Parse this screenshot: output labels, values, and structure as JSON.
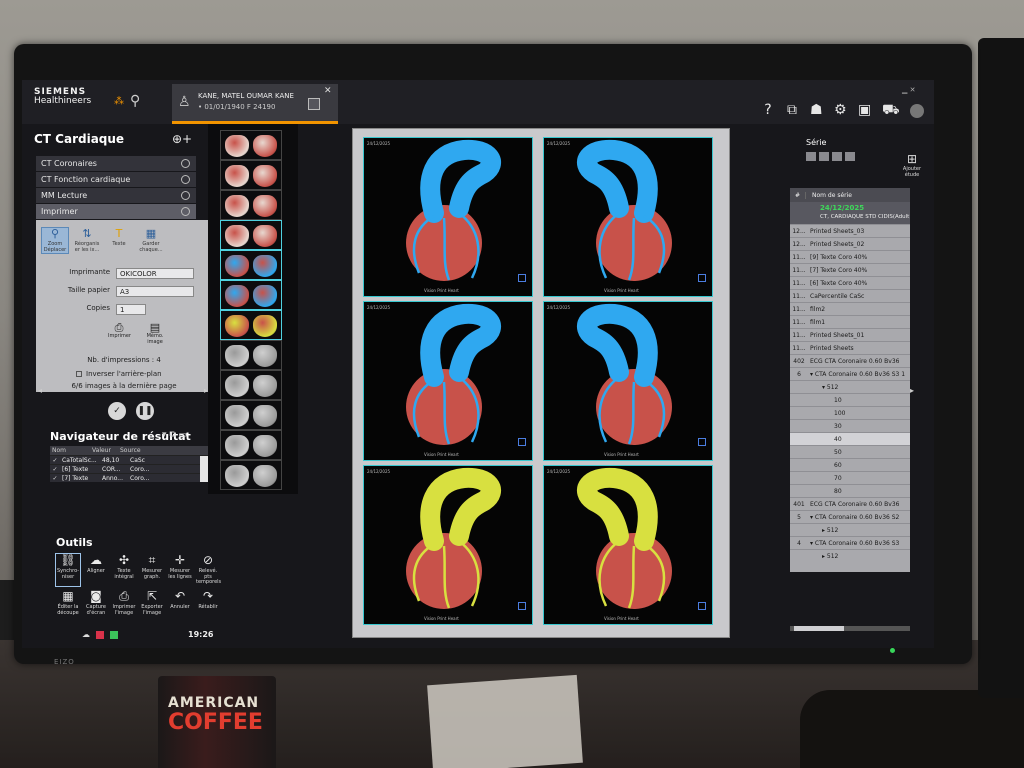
{
  "header": {
    "brand_line1": "SIEMENS",
    "brand_line2": "Healthineers",
    "patient_name": "KANE, MATEL OUMAR KANE",
    "patient_dob": "• 01/01/1940 F 24190",
    "icons": [
      "help-icon",
      "layout-icon",
      "users-icon",
      "gear-icon",
      "toolbox-icon",
      "cart-icon"
    ]
  },
  "left_panel": {
    "title": "CT Cardiaque",
    "protocols": [
      {
        "label": "CT Coronaires"
      },
      {
        "label": "CT Fonction cardiaque"
      },
      {
        "label": "MM Lecture"
      },
      {
        "label": "Imprimer"
      }
    ],
    "print_tools": [
      {
        "label": "Zoom Déplacer",
        "icon": "magnifier-icon"
      },
      {
        "label": "Réorganis er les ix...",
        "icon": "reorder-icon"
      },
      {
        "label": "Texte",
        "icon": "text-icon"
      },
      {
        "label": "Garder chaque...",
        "icon": "keep-icon"
      }
    ],
    "printer_label": "Imprimante",
    "printer_value": "OKICOLOR",
    "paper_label": "Taille papier",
    "paper_value": "A3",
    "copies_label": "Copies",
    "copies_value": "1",
    "print_button": "Imprimer",
    "memo_button": "Mémo. image",
    "nb_impressions": "Nb. d'impressions : 4",
    "invert_label": "Inverser l'arrière-plan",
    "last_page": "6/6 images à la dernière page"
  },
  "navigator": {
    "title": "Navigateur de résultat",
    "columns": [
      "Nom",
      "Valeur",
      "Source"
    ],
    "rows": [
      {
        "name": "CaTotalSc...",
        "value": "48,10",
        "source": "CaSc"
      },
      {
        "name": "[6] Texte",
        "value": "COR...",
        "source": "Coro..."
      },
      {
        "name": "[7] Texte",
        "value": "Anno...",
        "source": "Coro..."
      }
    ]
  },
  "tools": {
    "title": "Outils",
    "row1": [
      {
        "label": "Synchro-niser",
        "icon": "link-icon"
      },
      {
        "label": "Aligner",
        "icon": "align-icon"
      },
      {
        "label": "Texte intégral",
        "icon": "text-icon"
      },
      {
        "label": "Mesurer graph.",
        "icon": "graph-icon"
      },
      {
        "label": "Mesurer les lignes",
        "icon": "ruler-icon"
      },
      {
        "label": "Relevé. pts temporels",
        "icon": "timepoint-icon"
      }
    ],
    "row2": [
      {
        "label": "Éditer la découpe",
        "icon": "crop-icon"
      },
      {
        "label": "Capture d'écran",
        "icon": "camera-icon"
      },
      {
        "label": "Imprimer l'image",
        "icon": "printer-icon"
      },
      {
        "label": "Exporter l'image",
        "icon": "export-icon"
      },
      {
        "label": "Annuler",
        "icon": "undo-icon"
      },
      {
        "label": "Rétablir",
        "icon": "redo-icon"
      }
    ],
    "clock": "19:26"
  },
  "viewer": {
    "viewports": [
      {
        "label": "24/12/2025",
        "footer": "Vision Print Heart",
        "style": "blue"
      },
      {
        "label": "24/12/2025",
        "footer": "Vision Print Heart",
        "style": "blue"
      },
      {
        "label": "24/12/2025",
        "footer": "Vision Print Heart",
        "style": "blue"
      },
      {
        "label": "24/12/2025",
        "footer": "Vision Print Heart",
        "style": "blue"
      },
      {
        "label": "24/12/2025",
        "footer": "Vision Print Heart",
        "style": "yellow"
      },
      {
        "label": "24/12/2025",
        "footer": "Vision Print Heart",
        "style": "yellow"
      }
    ],
    "colors": {
      "aorta_blue": "#2fa8f0",
      "myocardium_red": "#c8524a",
      "vessel_yellow": "#d8e040",
      "frame_cyan": "#38c7cf"
    }
  },
  "series_panel": {
    "title": "Série",
    "add_label": "Ajouter étude",
    "column_hash": "#",
    "column_name": "Nom de série",
    "study_date": "24/12/2025",
    "study_desc": "CT, CARDIAQUE STD CIDIS(Adult)",
    "rows": [
      {
        "n": "12...",
        "t": "Printed Sheets_03",
        "lvl": 0,
        "sel": false
      },
      {
        "n": "12...",
        "t": "Printed Sheets_02",
        "lvl": 0,
        "sel": false
      },
      {
        "n": "11...",
        "t": "[9] Texte Coro 40%",
        "lvl": 0,
        "sel": false
      },
      {
        "n": "11...",
        "t": "[7] Texte Coro 40%",
        "lvl": 0,
        "sel": false
      },
      {
        "n": "11...",
        "t": "[6] Texte Coro 40%",
        "lvl": 0,
        "sel": false
      },
      {
        "n": "11...",
        "t": "CaPercentile CaSc",
        "lvl": 0,
        "sel": false
      },
      {
        "n": "11...",
        "t": "film2",
        "lvl": 0,
        "sel": false
      },
      {
        "n": "11...",
        "t": "film1",
        "lvl": 0,
        "sel": false
      },
      {
        "n": "11...",
        "t": "Printed Sheets_01",
        "lvl": 0,
        "sel": false
      },
      {
        "n": "11...",
        "t": "Printed Sheets",
        "lvl": 0,
        "sel": false
      },
      {
        "n": "402",
        "t": "ECG CTA Coronaire 0.60 Bv36",
        "lvl": 0,
        "sel": false
      },
      {
        "n": "6",
        "t": "▾ CTA Coronaire 0.60 Bv36 S3 1",
        "lvl": 0,
        "sel": false
      },
      {
        "n": "",
        "t": "▾ 512",
        "lvl": 1,
        "sel": false
      },
      {
        "n": "",
        "t": "10",
        "lvl": 2,
        "sel": false
      },
      {
        "n": "",
        "t": "100",
        "lvl": 2,
        "sel": false
      },
      {
        "n": "",
        "t": "30",
        "lvl": 2,
        "sel": false
      },
      {
        "n": "",
        "t": "40",
        "lvl": 2,
        "sel": true
      },
      {
        "n": "",
        "t": "50",
        "lvl": 2,
        "sel": false
      },
      {
        "n": "",
        "t": "60",
        "lvl": 2,
        "sel": false
      },
      {
        "n": "",
        "t": "70",
        "lvl": 2,
        "sel": false
      },
      {
        "n": "",
        "t": "80",
        "lvl": 2,
        "sel": false
      },
      {
        "n": "401",
        "t": "ECG CTA Coronaire 0.60 Bv36",
        "lvl": 0,
        "sel": false
      },
      {
        "n": "5",
        "t": "▾ CTA Coronaire 0.60 Bv36 S2",
        "lvl": 0,
        "sel": false
      },
      {
        "n": "",
        "t": "▸ 512",
        "lvl": 1,
        "sel": false
      },
      {
        "n": "4",
        "t": "▾ CTA Coronaire 0.60 Bv36 S3",
        "lvl": 0,
        "sel": false
      },
      {
        "n": "",
        "t": "▸ 512",
        "lvl": 1,
        "sel": false
      }
    ]
  },
  "surroundings": {
    "monitor_brand": "EIZO",
    "cup_line1": "AMERICAN",
    "cup_line2": "COFFEE"
  }
}
